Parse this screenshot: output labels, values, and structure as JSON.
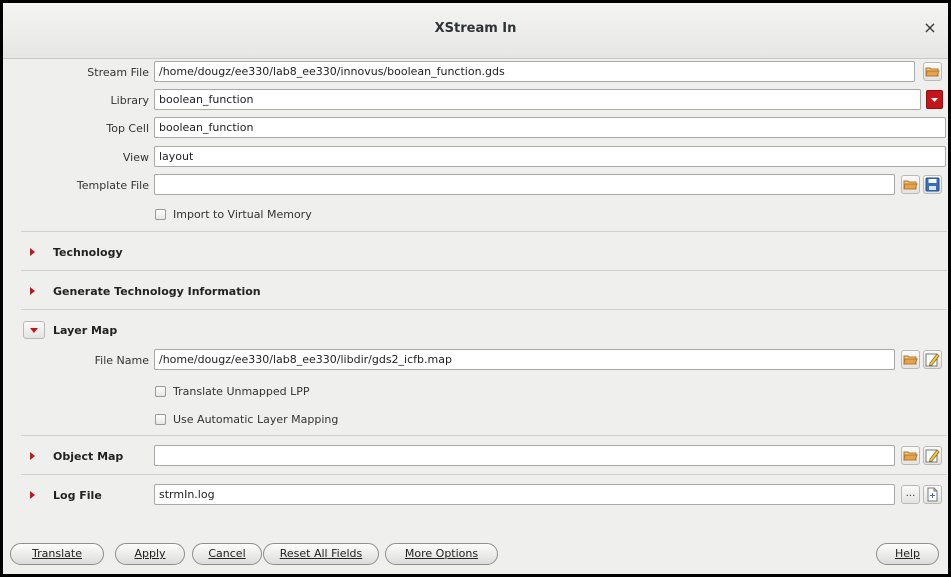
{
  "window": {
    "title": "XStream In",
    "close_glyph": "×"
  },
  "fields": {
    "stream_file": {
      "label": "Stream File",
      "value": "/home/dougz/ee330/lab8_ee330/innovus/boolean_function.gds"
    },
    "library": {
      "label": "Library",
      "value": "boolean_function"
    },
    "top_cell": {
      "label": "Top Cell",
      "value": "boolean_function"
    },
    "view": {
      "label": "View",
      "value": "layout"
    },
    "template_file": {
      "label": "Template File",
      "value": ""
    },
    "import_virtual_memory": {
      "label": "Import to Virtual Memory",
      "checked": false
    }
  },
  "sections": {
    "technology": {
      "title": "Technology",
      "expanded": false
    },
    "gen_tech_info": {
      "title": "Generate Technology Information",
      "expanded": false
    },
    "layer_map": {
      "title": "Layer Map",
      "expanded": true,
      "file_name_label": "File Name",
      "file_name_value": "/home/dougz/ee330/lab8_ee330/libdir/gds2_icfb.map",
      "translate_unmapped": {
        "label": "Translate Unmapped LPP",
        "checked": false
      },
      "auto_layer_mapping": {
        "label": "Use Automatic Layer Mapping",
        "checked": false
      }
    },
    "object_map": {
      "title": "Object Map",
      "value": ""
    },
    "log_file": {
      "title": "Log File",
      "value": "strmIn.log",
      "browse_label": "..."
    }
  },
  "buttons": {
    "translate": "Translate",
    "apply": "Apply",
    "cancel": "Cancel",
    "reset": "Reset All Fields",
    "more_options": "More Options",
    "help": "Help"
  },
  "icons": {
    "folder": "folder-open-icon",
    "save": "save-icon",
    "edit": "edit-icon",
    "new_file": "new-file-icon",
    "dropdown": "dropdown-icon"
  },
  "colors": {
    "accent_red": "#c4141c",
    "folder_orange": "#e8a24a",
    "save_blue": "#3a6fb7"
  }
}
